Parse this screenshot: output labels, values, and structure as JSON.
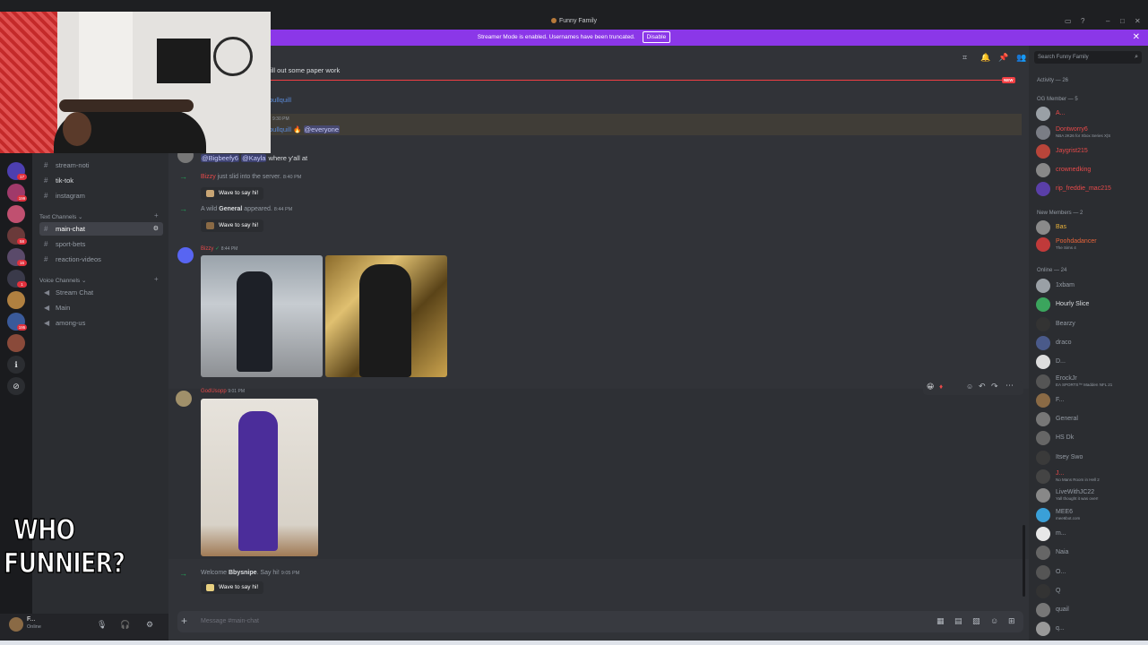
{
  "window": {
    "server_title": "Funny Family",
    "banner_text": "Streamer Mode is enabled. Usernames have been truncated.",
    "banner_button": "Disable",
    "banner_close": "✕"
  },
  "channels": {
    "top_items": [
      {
        "name": "stream-noti"
      },
      {
        "name": "tik-tok"
      },
      {
        "name": "instagram"
      }
    ],
    "text_category": "Text Channels",
    "text_items": [
      {
        "name": "main-chat"
      },
      {
        "name": "sport-bets"
      },
      {
        "name": "reaction-videos"
      }
    ],
    "voice_category": "Voice Channels",
    "voice_items": [
      {
        "name": "Stream Chat"
      },
      {
        "name": "Main"
      },
      {
        "name": "among-us"
      }
    ],
    "badges": [
      "17",
      "9",
      "199",
      "58",
      "16",
      "1",
      "195",
      "15"
    ]
  },
  "user_panel": {
    "name": "F...",
    "status": "Online"
  },
  "chat": {
    "partial_top": "fill out some paper work",
    "partial_user1": "bullquill",
    "partial_time": "9:30 PM",
    "partial_user2": "bullquill",
    "everyone": "@everyone",
    "new_tag": "NEW",
    "mention_line": {
      "m1": "@Bigbeefy6",
      "m2": "@Kayla",
      "rest": "where y'all at"
    },
    "join1": {
      "user": "Bizzy",
      "text": "just slid into the server.",
      "time": "8:40 PM"
    },
    "wave_label": "Wave to say hi!",
    "join2": {
      "prefix": "A wild",
      "user": "General",
      "text": "appeared.",
      "time": "8:44 PM"
    },
    "bizzy_post": {
      "user": "Bizzy",
      "time": "8:44 PM"
    },
    "godusopp_post": {
      "user": "GodUsopp",
      "time": "9:01 PM"
    },
    "join3": {
      "prefix": "Welcome",
      "user": "Bbysnipe",
      "text": ". Say hi!",
      "time": "9:05 PM"
    },
    "input_placeholder": "Message #main-chat"
  },
  "members": {
    "search_placeholder": "Search Funny Family",
    "activity_header": "Activity — 26",
    "og_header": "OG Member — 5",
    "og": [
      {
        "name": "A...",
        "sub": "",
        "color": "#e84a4a",
        "av": "#9aa0a6"
      },
      {
        "name": "Dontworry6",
        "sub": "NBA 2K26 for Xbox Series X|S",
        "color": "#e84a4a",
        "av": "#7a7d85"
      },
      {
        "name": "Jaygrist215",
        "sub": "",
        "color": "#e84a4a",
        "av": "#b8453a"
      },
      {
        "name": "crownedking",
        "sub": "",
        "color": "#e84a4a",
        "av": "#888"
      },
      {
        "name": "rip_freddie_mac215",
        "sub": "",
        "color": "#e84a4a",
        "av": "#5a3fa8"
      }
    ],
    "new_header": "New Members — 2",
    "newm": [
      {
        "name": "Bas",
        "sub": "",
        "color": "#e8b13a",
        "av": "#8a8a8a"
      },
      {
        "name": "Poohdadancer",
        "sub": "The Sims 4",
        "color": "#e8643a",
        "av": "#c03a3a"
      }
    ],
    "online_header": "Online — 24",
    "online": [
      {
        "name": "1xbam",
        "sub": "",
        "color": "#949ba4",
        "av": "#9aa0a6"
      },
      {
        "name": "Hourly Slice",
        "sub": "",
        "color": "#dbdee1",
        "av": "#3ba55d"
      },
      {
        "name": "Bearzy",
        "sub": "",
        "color": "#949ba4",
        "av": "#333"
      },
      {
        "name": "draco",
        "sub": "",
        "color": "#949ba4",
        "av": "#4a5a8a"
      },
      {
        "name": "D...",
        "sub": "",
        "color": "#949ba4",
        "av": "#ddd"
      },
      {
        "name": "ErockJr",
        "sub": "EA SPORTS™ Madden NFL 21",
        "color": "#949ba4",
        "av": "#555"
      },
      {
        "name": "F...",
        "sub": "",
        "color": "#949ba4",
        "av": "#8a6a45"
      },
      {
        "name": "General",
        "sub": "",
        "color": "#949ba4",
        "av": "#777"
      },
      {
        "name": "HS Dk",
        "sub": "",
        "color": "#949ba4",
        "av": "#666"
      },
      {
        "name": "Itsey Swo",
        "sub": "",
        "color": "#949ba4",
        "av": "#3a3a3a"
      },
      {
        "name": "J...",
        "sub": "No Mans Room in Hell 2",
        "color": "#e84a4a",
        "av": "#444"
      },
      {
        "name": "LiveWithJC22",
        "sub": "Yall thought it was over!",
        "color": "#949ba4",
        "av": "#888"
      },
      {
        "name": "MEE6",
        "sub": "mee6bot.com",
        "color": "#949ba4",
        "av": "#3aa0d8"
      },
      {
        "name": "m...",
        "sub": "",
        "color": "#949ba4",
        "av": "#e8e8e8"
      },
      {
        "name": "Naia",
        "sub": "",
        "color": "#949ba4",
        "av": "#666"
      },
      {
        "name": "O...",
        "sub": "",
        "color": "#949ba4",
        "av": "#555"
      },
      {
        "name": "Q",
        "sub": "",
        "color": "#949ba4",
        "av": "#333"
      },
      {
        "name": "quail",
        "sub": "",
        "color": "#949ba4",
        "av": "#777"
      },
      {
        "name": "q...",
        "sub": "",
        "color": "#949ba4",
        "av": "#999"
      }
    ]
  },
  "overlay": {
    "line1": "WHO",
    "line2": "FUNNIER?"
  }
}
